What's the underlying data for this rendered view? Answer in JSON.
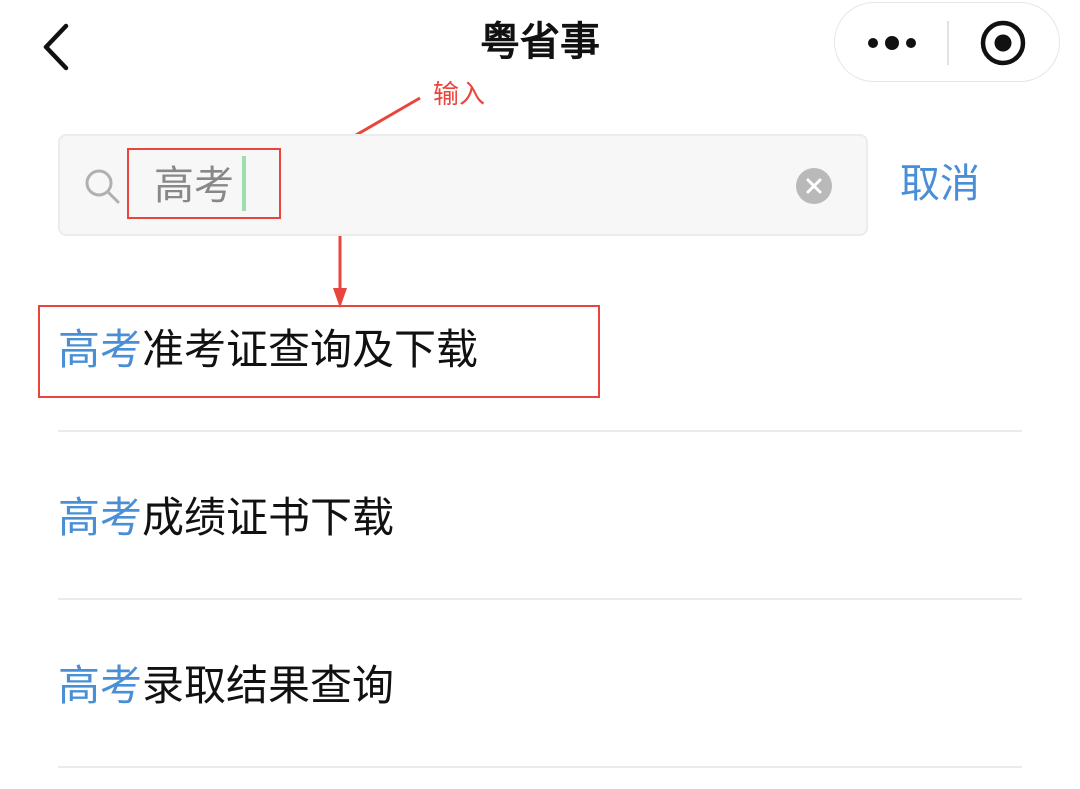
{
  "header": {
    "title": "粤省事",
    "back_icon": "chevron-left-icon",
    "more_icon": "ellipsis-icon",
    "close_icon": "target-circle-icon"
  },
  "annotation": {
    "label": "输入",
    "color": "#e8453c"
  },
  "search": {
    "value": "高考",
    "icon": "search-icon",
    "clear_icon": "clear-icon",
    "cancel_label": "取消"
  },
  "results": [
    {
      "keyword": "高考",
      "rest": "准考证查询及下载"
    },
    {
      "keyword": "高考",
      "rest": "成绩证书下载"
    },
    {
      "keyword": "高考",
      "rest": "录取结果查询"
    }
  ],
  "colors": {
    "accent": "#4a8fd6",
    "annotation": "#e8453c",
    "caret": "#9fdcae"
  }
}
